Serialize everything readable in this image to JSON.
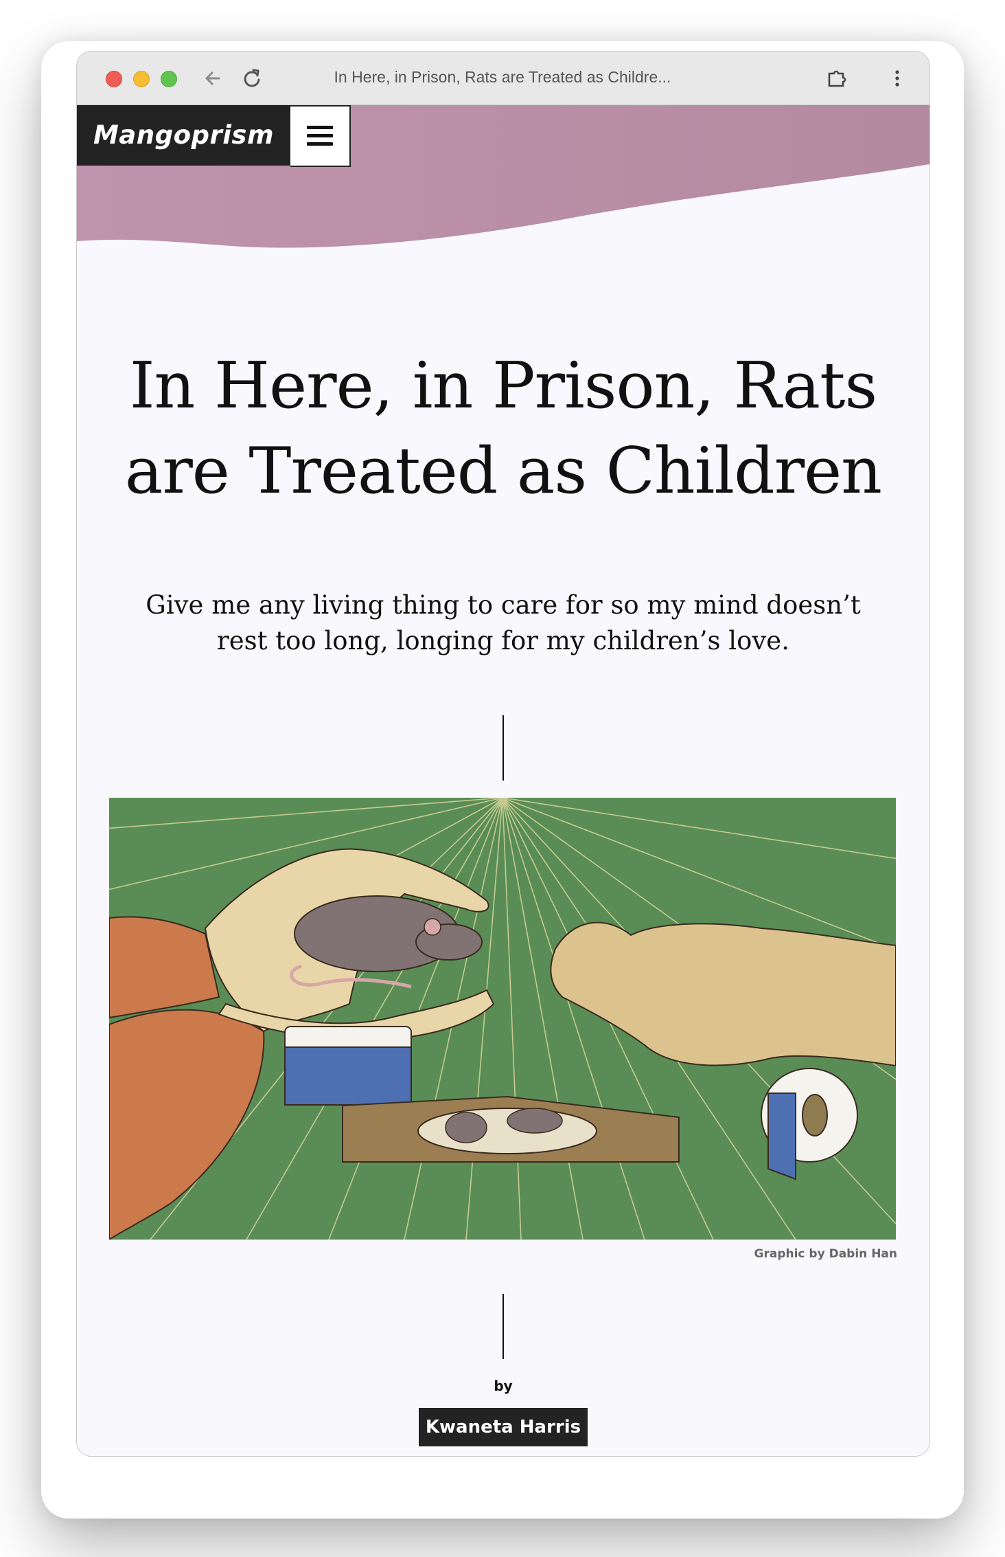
{
  "browser": {
    "tab_title": "In Here, in Prison, Rats are Treated as Childre...",
    "icons": [
      "back-arrow-icon",
      "reload-icon",
      "extension-icon",
      "more-vert-icon"
    ]
  },
  "site": {
    "brand": "Mangoprism",
    "menu_icon": "hamburger-menu-icon",
    "header_color": "#b98fa6"
  },
  "article": {
    "title": "In Here, in Prison, Rats are Treated as Children",
    "subtitle": "Give me any living thing to care for so my mind doesn’t rest too long, longing for my children’s love.",
    "image_caption": "Graphic by Dabin Han",
    "by_label": "by",
    "author": "Kwaneta Harris"
  }
}
